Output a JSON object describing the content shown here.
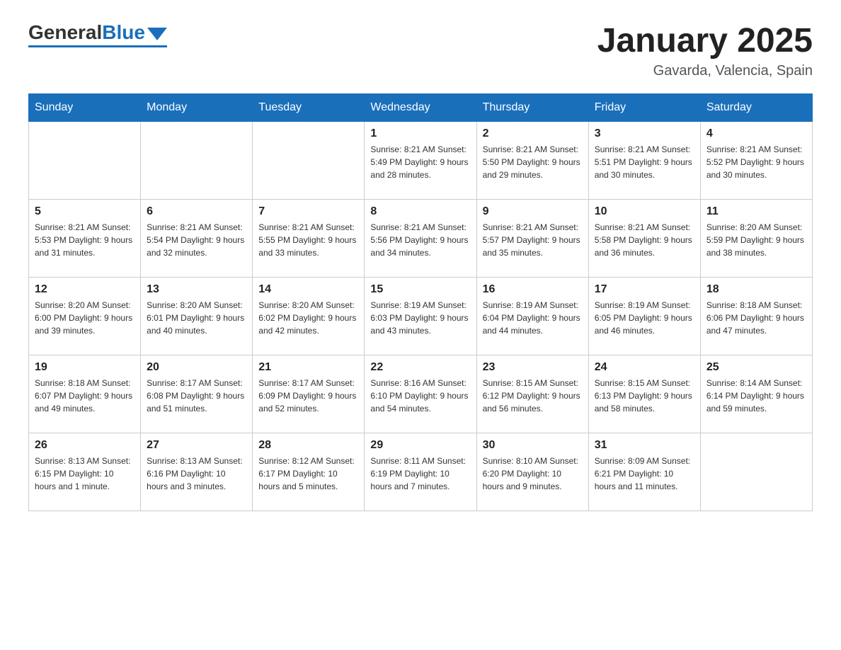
{
  "header": {
    "logo_general": "General",
    "logo_blue": "Blue",
    "title": "January 2025",
    "subtitle": "Gavarda, Valencia, Spain"
  },
  "days_of_week": [
    "Sunday",
    "Monday",
    "Tuesday",
    "Wednesday",
    "Thursday",
    "Friday",
    "Saturday"
  ],
  "weeks": [
    [
      {
        "day": "",
        "info": ""
      },
      {
        "day": "",
        "info": ""
      },
      {
        "day": "",
        "info": ""
      },
      {
        "day": "1",
        "info": "Sunrise: 8:21 AM\nSunset: 5:49 PM\nDaylight: 9 hours and 28 minutes."
      },
      {
        "day": "2",
        "info": "Sunrise: 8:21 AM\nSunset: 5:50 PM\nDaylight: 9 hours and 29 minutes."
      },
      {
        "day": "3",
        "info": "Sunrise: 8:21 AM\nSunset: 5:51 PM\nDaylight: 9 hours and 30 minutes."
      },
      {
        "day": "4",
        "info": "Sunrise: 8:21 AM\nSunset: 5:52 PM\nDaylight: 9 hours and 30 minutes."
      }
    ],
    [
      {
        "day": "5",
        "info": "Sunrise: 8:21 AM\nSunset: 5:53 PM\nDaylight: 9 hours and 31 minutes."
      },
      {
        "day": "6",
        "info": "Sunrise: 8:21 AM\nSunset: 5:54 PM\nDaylight: 9 hours and 32 minutes."
      },
      {
        "day": "7",
        "info": "Sunrise: 8:21 AM\nSunset: 5:55 PM\nDaylight: 9 hours and 33 minutes."
      },
      {
        "day": "8",
        "info": "Sunrise: 8:21 AM\nSunset: 5:56 PM\nDaylight: 9 hours and 34 minutes."
      },
      {
        "day": "9",
        "info": "Sunrise: 8:21 AM\nSunset: 5:57 PM\nDaylight: 9 hours and 35 minutes."
      },
      {
        "day": "10",
        "info": "Sunrise: 8:21 AM\nSunset: 5:58 PM\nDaylight: 9 hours and 36 minutes."
      },
      {
        "day": "11",
        "info": "Sunrise: 8:20 AM\nSunset: 5:59 PM\nDaylight: 9 hours and 38 minutes."
      }
    ],
    [
      {
        "day": "12",
        "info": "Sunrise: 8:20 AM\nSunset: 6:00 PM\nDaylight: 9 hours and 39 minutes."
      },
      {
        "day": "13",
        "info": "Sunrise: 8:20 AM\nSunset: 6:01 PM\nDaylight: 9 hours and 40 minutes."
      },
      {
        "day": "14",
        "info": "Sunrise: 8:20 AM\nSunset: 6:02 PM\nDaylight: 9 hours and 42 minutes."
      },
      {
        "day": "15",
        "info": "Sunrise: 8:19 AM\nSunset: 6:03 PM\nDaylight: 9 hours and 43 minutes."
      },
      {
        "day": "16",
        "info": "Sunrise: 8:19 AM\nSunset: 6:04 PM\nDaylight: 9 hours and 44 minutes."
      },
      {
        "day": "17",
        "info": "Sunrise: 8:19 AM\nSunset: 6:05 PM\nDaylight: 9 hours and 46 minutes."
      },
      {
        "day": "18",
        "info": "Sunrise: 8:18 AM\nSunset: 6:06 PM\nDaylight: 9 hours and 47 minutes."
      }
    ],
    [
      {
        "day": "19",
        "info": "Sunrise: 8:18 AM\nSunset: 6:07 PM\nDaylight: 9 hours and 49 minutes."
      },
      {
        "day": "20",
        "info": "Sunrise: 8:17 AM\nSunset: 6:08 PM\nDaylight: 9 hours and 51 minutes."
      },
      {
        "day": "21",
        "info": "Sunrise: 8:17 AM\nSunset: 6:09 PM\nDaylight: 9 hours and 52 minutes."
      },
      {
        "day": "22",
        "info": "Sunrise: 8:16 AM\nSunset: 6:10 PM\nDaylight: 9 hours and 54 minutes."
      },
      {
        "day": "23",
        "info": "Sunrise: 8:15 AM\nSunset: 6:12 PM\nDaylight: 9 hours and 56 minutes."
      },
      {
        "day": "24",
        "info": "Sunrise: 8:15 AM\nSunset: 6:13 PM\nDaylight: 9 hours and 58 minutes."
      },
      {
        "day": "25",
        "info": "Sunrise: 8:14 AM\nSunset: 6:14 PM\nDaylight: 9 hours and 59 minutes."
      }
    ],
    [
      {
        "day": "26",
        "info": "Sunrise: 8:13 AM\nSunset: 6:15 PM\nDaylight: 10 hours and 1 minute."
      },
      {
        "day": "27",
        "info": "Sunrise: 8:13 AM\nSunset: 6:16 PM\nDaylight: 10 hours and 3 minutes."
      },
      {
        "day": "28",
        "info": "Sunrise: 8:12 AM\nSunset: 6:17 PM\nDaylight: 10 hours and 5 minutes."
      },
      {
        "day": "29",
        "info": "Sunrise: 8:11 AM\nSunset: 6:19 PM\nDaylight: 10 hours and 7 minutes."
      },
      {
        "day": "30",
        "info": "Sunrise: 8:10 AM\nSunset: 6:20 PM\nDaylight: 10 hours and 9 minutes."
      },
      {
        "day": "31",
        "info": "Sunrise: 8:09 AM\nSunset: 6:21 PM\nDaylight: 10 hours and 11 minutes."
      },
      {
        "day": "",
        "info": ""
      }
    ]
  ]
}
